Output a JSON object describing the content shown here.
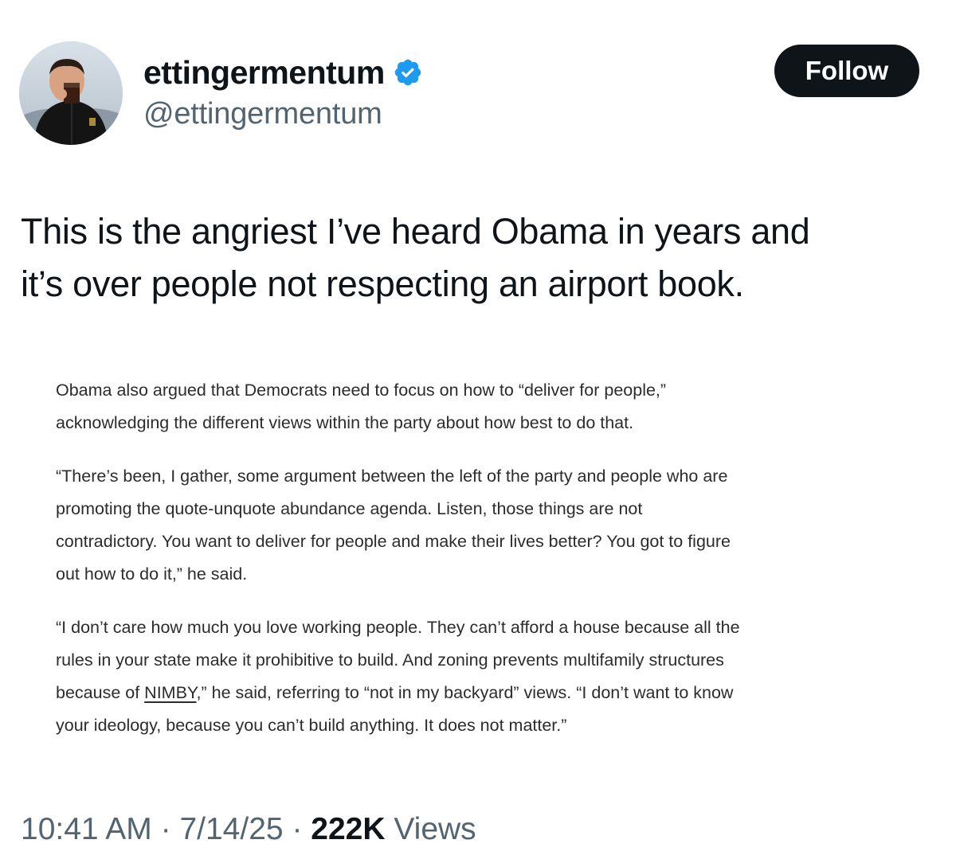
{
  "author": {
    "display_name": "ettingermentum",
    "handle": "@ettingermentum",
    "verified_icon": "verified-badge-icon",
    "verified_color": "#1d9bf0"
  },
  "follow_button": {
    "label": "Follow"
  },
  "tweet": {
    "text_lines": [
      "This is the angriest I’ve heard Obama in years and",
      "it’s over people not respecting an airport book."
    ]
  },
  "article_image": {
    "p1": [
      "Obama also argued that Democrats need to focus on how to “deliver for people,”",
      "acknowledging the different views within the party about how best to do that."
    ],
    "p2": [
      "“There’s been, I gather, some argument between the left of the party and people who are",
      "promoting the quote-unquote abundance agenda. Listen, those things are not",
      "contradictory. You want to deliver for people and make their lives better? You got to figure",
      "out how to do it,” he said."
    ],
    "p3": {
      "line1": "“I don’t care how much you love working people. They can’t afford a house because all the",
      "line2": "rules in your state make it prohibitive to build. And zoning prevents multifamily structures",
      "line3_before": "because of ",
      "line3_link": "NIMBY",
      "line3_after": ",” he said, referring to “not in my backyard” views. “I don’t want to know",
      "line4": "your ideology, because you can’t build anything. It does not matter.”"
    }
  },
  "meta": {
    "time": "10:41 AM",
    "separator": "·",
    "date": "7/14/25",
    "views_count": "222K",
    "views_label": "Views"
  },
  "colors": {
    "text_primary": "#0f1419",
    "text_secondary": "#536471",
    "follow_bg": "#0f1419"
  }
}
